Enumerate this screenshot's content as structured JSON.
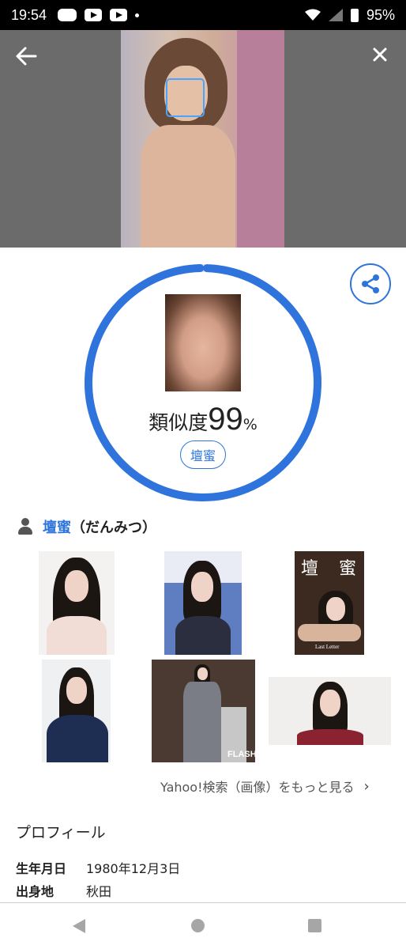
{
  "status_bar": {
    "time": "19:54",
    "battery": "95%"
  },
  "icons": {
    "back": "arrow-left-icon",
    "close": "close-icon",
    "share": "share-icon",
    "person": "person-icon",
    "chevron": "chevron-right-icon"
  },
  "result": {
    "similarity_label": "類似度",
    "similarity_value": "99",
    "similarity_unit": "%",
    "similarity_score": 0.99,
    "name_chip": "壇蜜"
  },
  "person": {
    "name": "壇蜜",
    "reading": "（だんみつ）"
  },
  "thumbnails": {
    "t3_title_1": "壇",
    "t3_title_2": "蜜",
    "t3_subtitle": "Last Letter",
    "t5_badge": "FLASH"
  },
  "more_link": {
    "label": "Yahoo!検索（画像）をもっと見る",
    "chevron": "›"
  },
  "profile": {
    "title": "プロフィール",
    "rows": [
      {
        "key": "生年月日",
        "value": "1980年12月3日"
      },
      {
        "key": "出身地",
        "value": "秋田"
      }
    ]
  },
  "colors": {
    "accent": "#2f74dc",
    "face_box": "#4aa3ff"
  }
}
